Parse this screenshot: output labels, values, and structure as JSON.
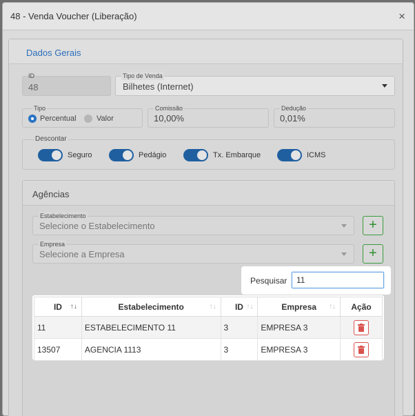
{
  "modal": {
    "title": "48 - Venda Voucher (Liberação)",
    "close_glyph": "×"
  },
  "dados_gerais": {
    "title": "Dados Gerais",
    "id": {
      "label": "ID",
      "value": "48"
    },
    "tipo_venda": {
      "label": "Tipo de Venda",
      "value": "Bilhetes (Internet)"
    },
    "tipo": {
      "label": "Tipo",
      "options": [
        "Percentual",
        "Valor"
      ],
      "selected": "Percentual"
    },
    "comissao": {
      "label": "Comissão",
      "value": "10,00%"
    },
    "deducao": {
      "label": "Dedução",
      "value": "0,01%"
    },
    "descontar": {
      "label": "Descontar",
      "toggles": [
        {
          "label": "Seguro",
          "on": true
        },
        {
          "label": "Pedágio",
          "on": true
        },
        {
          "label": "Tx. Embarque",
          "on": true
        },
        {
          "label": "ICMS",
          "on": true
        }
      ]
    }
  },
  "agencias": {
    "title": "Agências",
    "estabelecimento": {
      "label": "Estabelecimento",
      "placeholder": "Selecione o Estabelecimento"
    },
    "empresa": {
      "label": "Empresa",
      "placeholder": "Selecione a Empresa"
    },
    "add_glyph": "+",
    "search": {
      "label": "Pesquisar",
      "value": "11"
    },
    "table": {
      "headers": [
        "ID",
        "Estabelecimento",
        "ID",
        "Empresa",
        "Ação"
      ],
      "rows": [
        [
          "11",
          "ESTABELECIMENTO 11",
          "3",
          "EMPRESA 3"
        ],
        [
          "13507",
          "AGENCIA 1113",
          "3",
          "EMPRESA 3"
        ]
      ]
    }
  },
  "colors": {
    "accent": "#2a74c3",
    "toggle": "#1f5fa0",
    "success": "#3c9a3c",
    "danger": "#d9534f"
  }
}
